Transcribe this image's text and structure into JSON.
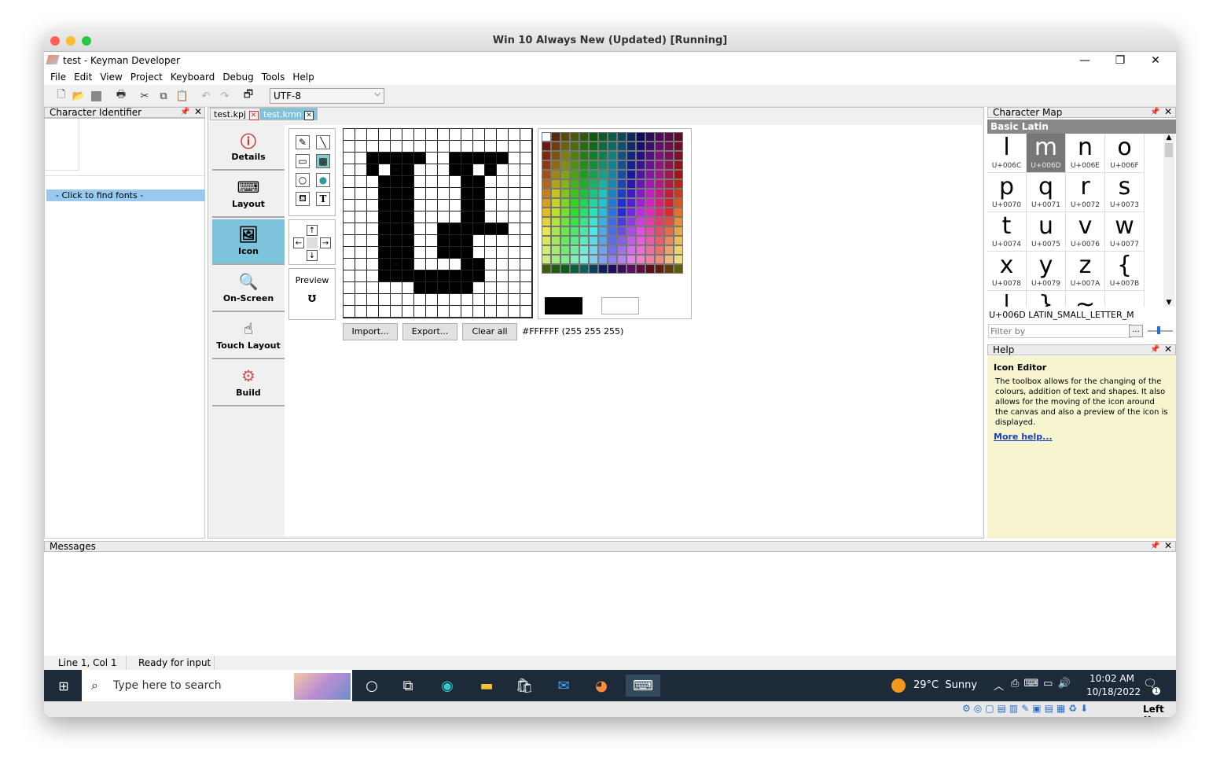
{
  "vm_title": "Win 10 Always New (Updated) [Running]",
  "app_title": "test - Keyman Developer",
  "menu": [
    "File",
    "Edit",
    "View",
    "Project",
    "Keyboard",
    "Debug",
    "Tools",
    "Help"
  ],
  "encoding": "UTF-8",
  "char_identifier": {
    "title": "Character Identifier",
    "font_row": "- Click to find fonts -"
  },
  "tabs": [
    {
      "label": "test.kpj"
    },
    {
      "label": "test.kmn"
    }
  ],
  "sidebar": [
    {
      "label": "Details",
      "icon": "info-icon"
    },
    {
      "label": "Layout",
      "icon": "keyboard-icon"
    },
    {
      "label": "Icon",
      "icon": "icon-editor-icon"
    },
    {
      "label": "On-Screen",
      "icon": "onscreen-keyboard-icon"
    },
    {
      "label": "Touch Layout",
      "icon": "touch-icon"
    },
    {
      "label": "Build",
      "icon": "gear-icon"
    }
  ],
  "icon_editor": {
    "preview_label": "Preview",
    "preview_glyph": "Ʊ",
    "import_label": "Import...",
    "export_label": "Export...",
    "clear_label": "Clear all",
    "color_readout": "#FFFFFF (255 255 255)",
    "fg_color": "#000000",
    "bg_color": "#FFFFFF"
  },
  "char_map": {
    "title": "Character Map",
    "block": "Basic Latin",
    "cells": [
      {
        "g": "l",
        "u": "U+006C"
      },
      {
        "g": "m",
        "u": "U+006D"
      },
      {
        "g": "n",
        "u": "U+006E"
      },
      {
        "g": "o",
        "u": "U+006F"
      },
      {
        "g": "p",
        "u": "U+0070"
      },
      {
        "g": "q",
        "u": "U+0071"
      },
      {
        "g": "r",
        "u": "U+0072"
      },
      {
        "g": "s",
        "u": "U+0073"
      },
      {
        "g": "t",
        "u": "U+0074"
      },
      {
        "g": "u",
        "u": "U+0075"
      },
      {
        "g": "v",
        "u": "U+0076"
      },
      {
        "g": "w",
        "u": "U+0077"
      },
      {
        "g": "x",
        "u": "U+0078"
      },
      {
        "g": "y",
        "u": "U+0079"
      },
      {
        "g": "z",
        "u": "U+007A"
      },
      {
        "g": "{",
        "u": "U+007B"
      },
      {
        "g": "|",
        "u": ""
      },
      {
        "g": "}",
        "u": ""
      },
      {
        "g": "~",
        "u": ""
      },
      {
        "g": "",
        "u": ""
      }
    ],
    "selected_name": "U+006D LATIN_SMALL_LETTER_M",
    "filter_placeholder": "Filter by",
    "filter_button": "..."
  },
  "help": {
    "title": "Help",
    "heading": "Icon Editor",
    "body": "The toolbox allows for the changing of the colours, addition of text and shapes. It also allows for the moving of the icon around the canvas and also a preview of the icon is displayed.",
    "link": "More help..."
  },
  "messages_title": "Messages",
  "status": {
    "position": "Line 1, Col 1",
    "state": "Ready for input"
  },
  "taskbar": {
    "search_placeholder": "Type here to search",
    "weather": "29°C  Sunny",
    "time": "10:02 AM",
    "date": "10/18/2022",
    "notifications": "1"
  },
  "host_tray": {
    "key_label": "Left ⌘"
  }
}
